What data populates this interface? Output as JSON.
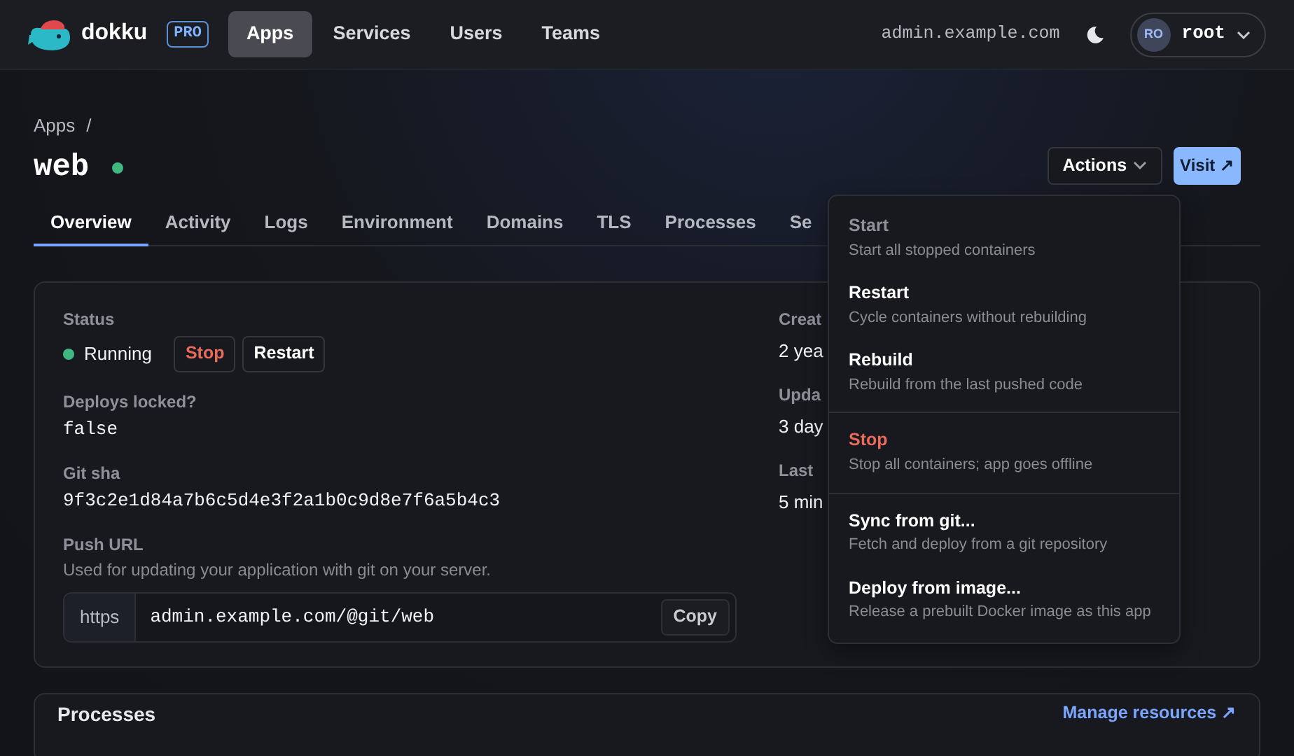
{
  "navbar": {
    "brand": "dokku",
    "badge": "PRO",
    "links": [
      {
        "label": "Apps",
        "selected": true
      },
      {
        "label": "Services",
        "selected": false
      },
      {
        "label": "Users",
        "selected": false
      },
      {
        "label": "Teams",
        "selected": false
      }
    ],
    "host": "admin.example.com",
    "user": {
      "initials": "RO",
      "name": "root"
    }
  },
  "breadcrumb": {
    "items": [
      "Apps"
    ],
    "separator": "/"
  },
  "app": {
    "name": "web",
    "online": true
  },
  "header_buttons": {
    "actions": "Actions",
    "visit": "Visit ↗"
  },
  "tabs": [
    {
      "label": "Overview",
      "selected": true
    },
    {
      "label": "Activity",
      "selected": false
    },
    {
      "label": "Logs",
      "selected": false
    },
    {
      "label": "Environment",
      "selected": false
    },
    {
      "label": "Domains",
      "selected": false
    },
    {
      "label": "TLS",
      "selected": false
    },
    {
      "label": "Processes",
      "selected": false
    },
    {
      "label": "Se",
      "selected": false
    }
  ],
  "details": {
    "left": [
      {
        "kind": "status",
        "label": "Status",
        "value": "Running",
        "online": true,
        "buttons": [
          {
            "label": "Stop",
            "kind": "danger"
          },
          {
            "label": "Restart",
            "kind": "normal"
          }
        ]
      },
      {
        "kind": "mono",
        "label": "Deploys locked?",
        "value": "false"
      },
      {
        "kind": "mono",
        "label": "Git sha",
        "value": "9f3c2e1d84a7b6c5d4e3f2a1b0c9d8e7f6a5b4c3"
      },
      {
        "kind": "url",
        "label": "Push URL",
        "hint": "Used for updating your application with git on your server.",
        "prefix": "https",
        "value": "admin.example.com/@git/web",
        "button": "Copy"
      }
    ],
    "right": [
      {
        "label": "Creat",
        "value": "2 yea"
      },
      {
        "label": "Upda",
        "value": "3 day"
      },
      {
        "label": "Last",
        "value": "5 min"
      }
    ]
  },
  "actions_menu": {
    "groups": [
      [
        {
          "title": "Start",
          "description": "Start all stopped containers",
          "disabled": true,
          "kind": "normal"
        },
        {
          "title": "Restart",
          "description": "Cycle containers without rebuilding",
          "disabled": false,
          "kind": "normal"
        },
        {
          "title": "Rebuild",
          "description": "Rebuild from the last pushed code",
          "disabled": false,
          "kind": "normal"
        }
      ],
      [
        {
          "title": "Stop",
          "description": "Stop all containers; app goes offline",
          "disabled": false,
          "kind": "danger"
        }
      ],
      [
        {
          "title": "Sync from git...",
          "description": "Fetch and deploy from a git repository",
          "disabled": false,
          "kind": "normal"
        },
        {
          "title": "Deploy from image...",
          "description": "Release a prebuilt Docker image as this app",
          "disabled": false,
          "kind": "normal"
        }
      ]
    ]
  },
  "processes": {
    "title": "Processes",
    "link": "Manage resources ↗"
  }
}
